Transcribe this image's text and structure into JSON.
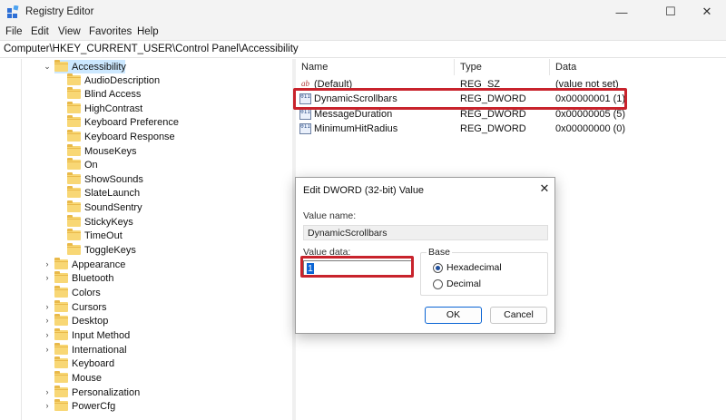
{
  "window": {
    "title": "Registry Editor",
    "minimize_glyph": "—",
    "maximize_glyph": "☐",
    "close_glyph": "✕"
  },
  "menu": [
    "File",
    "Edit",
    "View",
    "Favorites",
    "Help"
  ],
  "address": "Computer\\HKEY_CURRENT_USER\\Control Panel\\Accessibility",
  "tree": {
    "selected": "Accessibility",
    "children": [
      "AudioDescription",
      "Blind Access",
      "HighContrast",
      "Keyboard Preference",
      "Keyboard Response",
      "MouseKeys",
      "On",
      "ShowSounds",
      "SlateLaunch",
      "SoundSentry",
      "StickyKeys",
      "TimeOut",
      "ToggleKeys"
    ],
    "siblings": [
      "Appearance",
      "Bluetooth",
      "Colors",
      "Cursors",
      "Desktop",
      "Input Method",
      "International",
      "Keyboard",
      "Mouse",
      "Personalization",
      "PowerCfg"
    ]
  },
  "list": {
    "columns": [
      "Name",
      "Type",
      "Data"
    ],
    "rows": [
      {
        "icon": "string-value-icon",
        "icon_text": "ab",
        "name": "(Default)",
        "type": "REG_SZ",
        "data": "(value not set)"
      },
      {
        "icon": "dword-value-icon",
        "icon_text": "011",
        "name": "DynamicScrollbars",
        "type": "REG_DWORD",
        "data": "0x00000001 (1)"
      },
      {
        "icon": "dword-value-icon",
        "icon_text": "011",
        "name": "MessageDuration",
        "type": "REG_DWORD",
        "data": "0x00000005 (5)"
      },
      {
        "icon": "dword-value-icon",
        "icon_text": "011",
        "name": "MinimumHitRadius",
        "type": "REG_DWORD",
        "data": "0x00000000 (0)"
      }
    ]
  },
  "dialog": {
    "title": "Edit DWORD (32-bit) Value",
    "close_glyph": "✕",
    "value_name_label": "Value name:",
    "value_name": "DynamicScrollbars",
    "value_data_label": "Value data:",
    "value_data": "1",
    "base_label": "Base",
    "hexadecimal_label": "Hexadecimal",
    "decimal_label": "Decimal",
    "selected_base": "Hexadecimal",
    "ok_label": "OK",
    "cancel_label": "Cancel"
  },
  "colors": {
    "highlight_border": "#c8232c",
    "selection": "#cce8ff",
    "folder": "#f8d775",
    "accent": "#0a64d4"
  }
}
